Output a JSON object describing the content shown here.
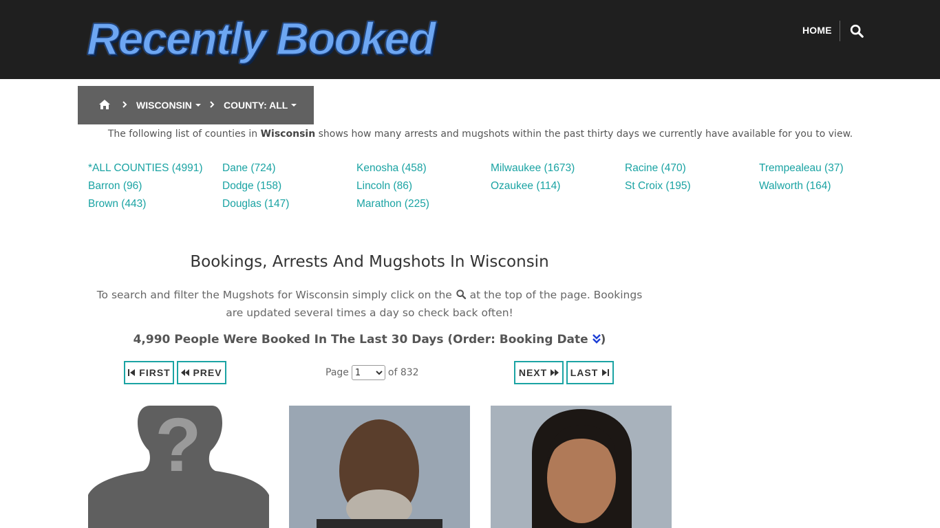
{
  "header": {
    "logo": "Recently Booked",
    "nav_home": "HOME",
    "search_icon": "search-icon"
  },
  "breadcrumb": {
    "home_icon": "home-icon",
    "state": "WISCONSIN",
    "county": "COUNTY: ALL"
  },
  "intro": {
    "before": "The following list of counties in ",
    "state": "Wisconsin",
    "after": " shows how many arrests and mugshots within the past thirty days we currently have available for you to view."
  },
  "counties": [
    [
      "*ALL COUNTIES (4991)",
      "Barron (96)",
      "Brown (443)"
    ],
    [
      "Dane (724)",
      "Dodge (158)",
      "Douglas (147)"
    ],
    [
      "Kenosha (458)",
      "Lincoln (86)",
      "Marathon (225)"
    ],
    [
      "Milwaukee (1673)",
      "Ozaukee (114)"
    ],
    [
      "Racine (470)",
      "St Croix (195)"
    ],
    [
      "Trempealeau (37)",
      "Walworth (164)"
    ]
  ],
  "main": {
    "heading": "Bookings, Arrests And Mugshots In Wisconsin",
    "sub_before": "To search and filter the Mugshots for Wisconsin simply click on the ",
    "sub_after": " at the top of the page. Bookings are updated several times a day so check back often!",
    "count_text": "4,990 People Were Booked In The Last 30 Days (Order: Booking Date ",
    "count_close": ")"
  },
  "pagination": {
    "first": "FIRST",
    "prev": "PREV",
    "next": "NEXT",
    "last": "LAST",
    "page_label": "Page",
    "current_page": "1",
    "of_label": "of 832"
  },
  "colors": {
    "accent": "#1aa3a3",
    "header_bg": "#1f1f1f",
    "breadcrumb_bg": "#616161",
    "logo_blue": "#6da6f2"
  }
}
